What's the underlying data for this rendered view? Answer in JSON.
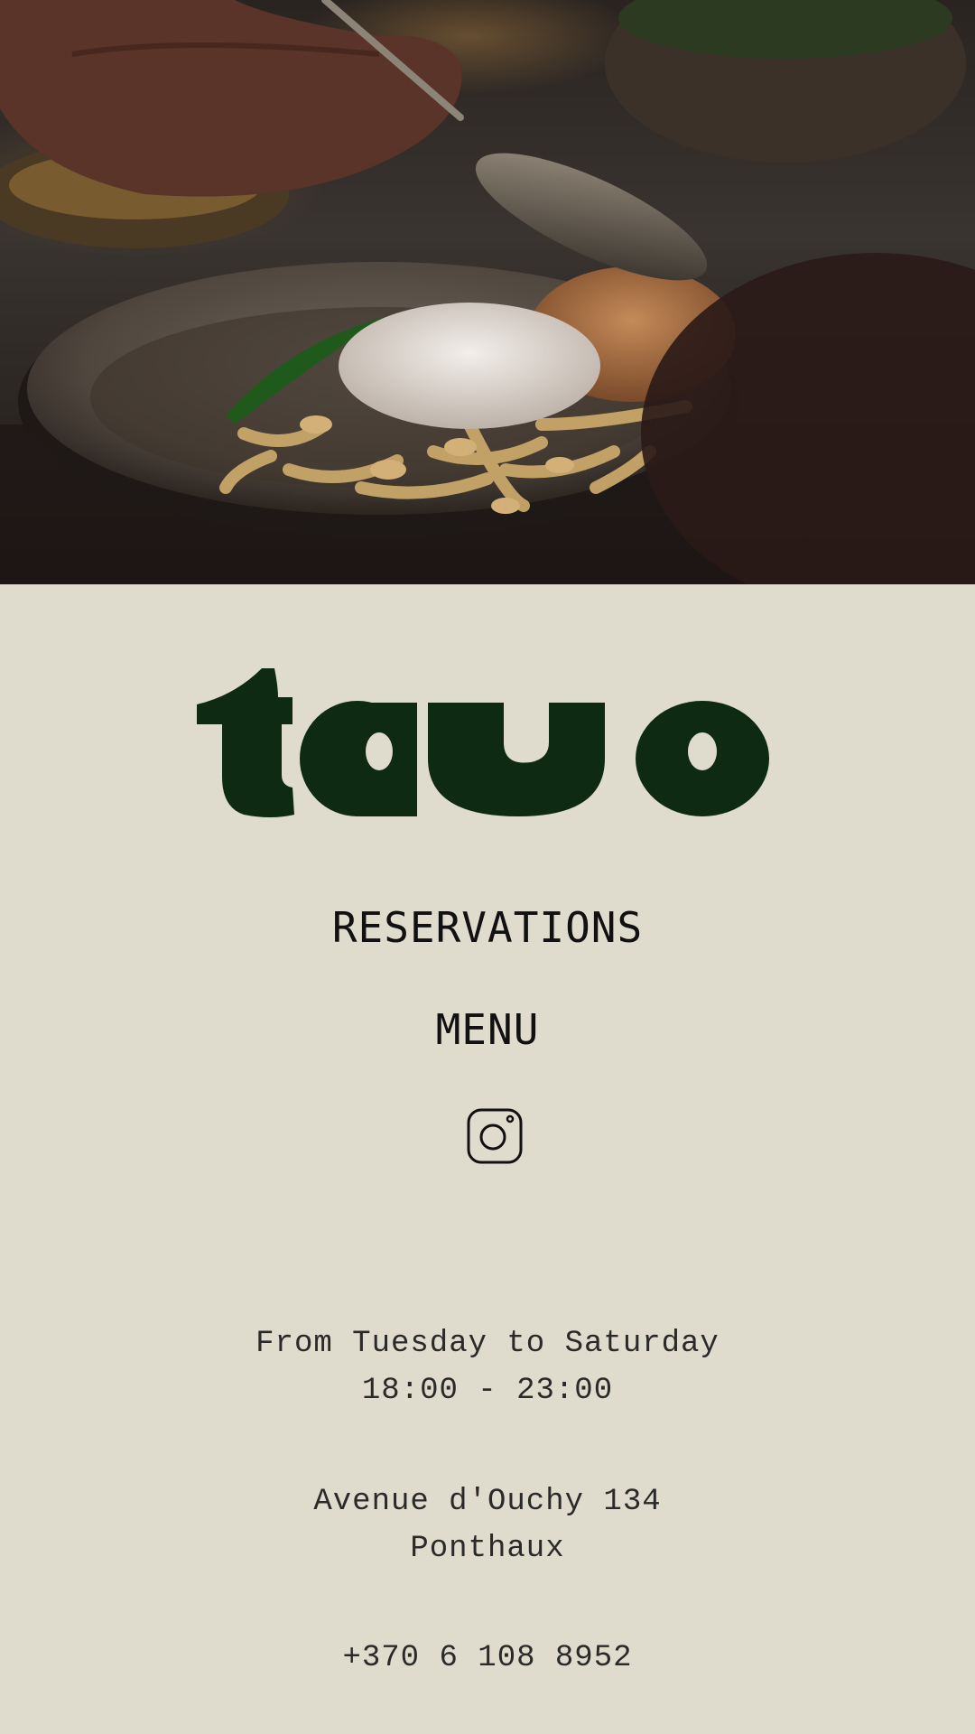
{
  "brand": {
    "logo_text": "tavo",
    "logo_color": "#0e2a12",
    "background_color": "#e0dccd"
  },
  "hero": {
    "icon": "food-photo"
  },
  "nav": {
    "reservations_label": "RESERVATIONS",
    "menu_label": "MENU",
    "instagram_icon": "instagram-icon"
  },
  "info": {
    "days": "From Tuesday to Saturday",
    "hours": "18:00 - 23:00",
    "street": "Avenue d'Ouchy 134",
    "city": "Ponthaux",
    "phone": "+370 6 108 8952"
  }
}
